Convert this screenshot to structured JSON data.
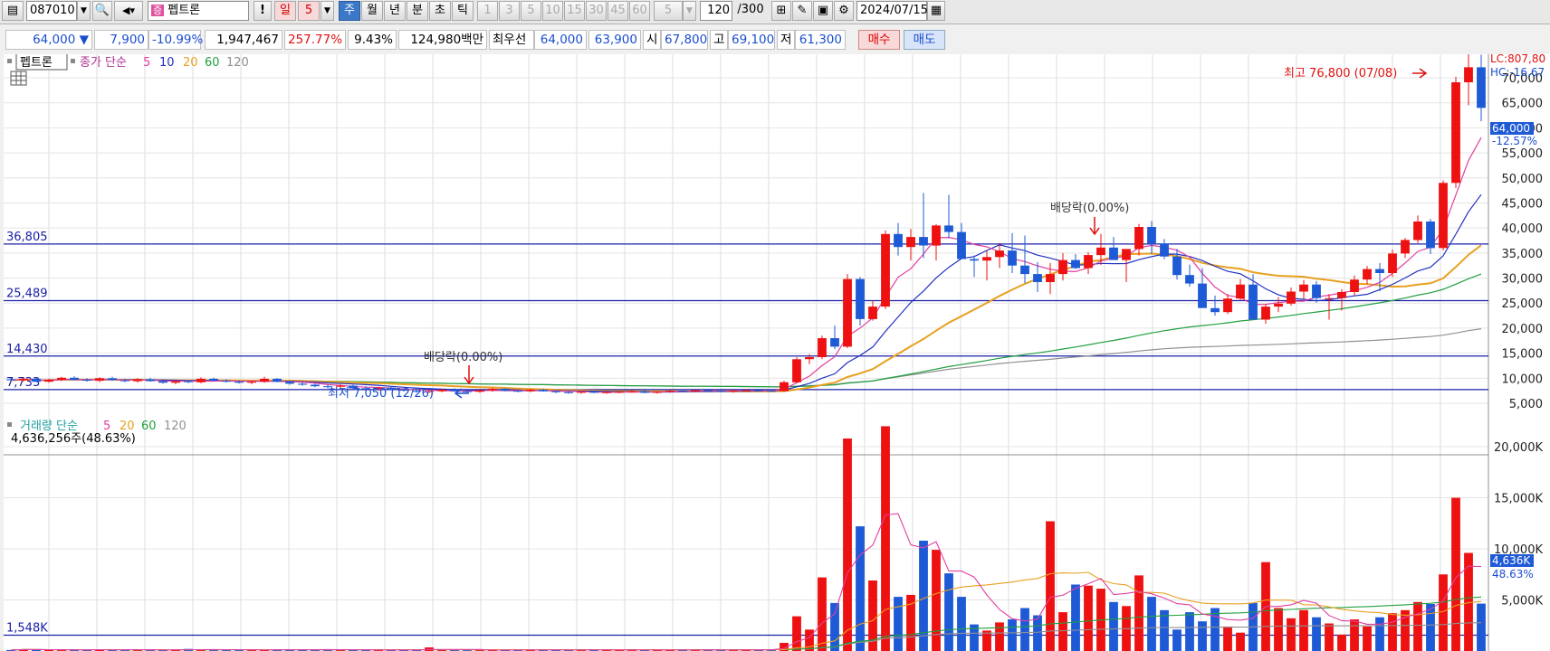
{
  "toolbar": {
    "code": "087010",
    "stock_badge": "증",
    "stock_name": "펩트론",
    "period_day": "일",
    "period_day_n": "5",
    "period_week": "주",
    "period_month": "월",
    "period_year": "년",
    "period_minute": "분",
    "period_second": "초",
    "period_tick": "틱",
    "intervals": [
      "1",
      "3",
      "5",
      "10",
      "15",
      "30",
      "45",
      "60"
    ],
    "interval_sel": "5",
    "count": "120",
    "count_max": "/300",
    "date": "2024/07/15"
  },
  "quote": {
    "price": "64,000",
    "change": "7,900",
    "change_pct": "-10.99%",
    "volume": "1,947,467",
    "volume_ratio": "257.77%",
    "turnover": "9.43%",
    "amount": "124,980백만",
    "best_label": "최우선",
    "best_ask": "64,000",
    "best_bid": "63,900",
    "open_label": "시",
    "open": "67,800",
    "high_label": "고",
    "high": "69,100",
    "low_label": "저",
    "low": "61,300",
    "buy_label": "매수",
    "sell_label": "매도"
  },
  "legend": {
    "name": "펩트론",
    "price_ma": "종가 단순",
    "periods": [
      "5",
      "10",
      "20",
      "60",
      "120"
    ],
    "vol_label": "거래량 단순",
    "vol_info": "4,636,256주(48.63%)"
  },
  "colors": {
    "up": "#ee1111",
    "down": "#1f5ad6",
    "ma5": "#e040a0",
    "ma10": "#2030c0",
    "ma20": "#e8a020",
    "ma60": "#20a040",
    "ma120": "#909090",
    "hline": "#1a20a8"
  },
  "chart_data": {
    "type": "candlestick",
    "period": "weekly",
    "price_axis": {
      "ticks": [
        5000,
        10000,
        15000,
        20000,
        25000,
        30000,
        35000,
        40000,
        45000,
        50000,
        55000,
        60000,
        65000,
        70000
      ],
      "tick_labels": [
        "5,000",
        "10,000",
        "15,000",
        "20,000",
        "25,000",
        "30,000",
        "35,000",
        "40,000",
        "45,000",
        "50,000",
        "55,000",
        "60,000",
        "65,000",
        "70,000"
      ],
      "ylim": [
        3000,
        78000
      ]
    },
    "volume_axis": {
      "ticks": [
        5000,
        10000,
        15000,
        20000
      ],
      "tick_labels": [
        "5,000K",
        "10,000K",
        "15,000K",
        "20,000K"
      ],
      "unit": "K"
    },
    "hlines": [
      {
        "label": "36,805",
        "value": 36805
      },
      {
        "label": "25,489",
        "value": 25489
      },
      {
        "label": "14,430",
        "value": 14430
      },
      {
        "label": "7,733",
        "value": 7733
      }
    ],
    "vol_hline": {
      "label": "1,548K",
      "value": 1548
    },
    "annotations": {
      "high": "최고 76,800 (07/08)",
      "low": "최저 7,050 (12/26)",
      "div1": "배당락(0.00%)",
      "div2": "배당락(0.00%)",
      "lc": "LC:807,80",
      "hc": "HC:-16,67",
      "last_price": "64,000",
      "last_pct": "-12.57%",
      "last_vol": "4,636K",
      "last_vol_pct": "48.63%"
    },
    "candles": [
      [
        9800,
        10200,
        9400,
        9600
      ],
      [
        9600,
        10100,
        9300,
        9900
      ],
      [
        9900,
        10000,
        9200,
        9300
      ],
      [
        9300,
        9900,
        9100,
        9700
      ],
      [
        9700,
        10300,
        9400,
        10100
      ],
      [
        10100,
        10400,
        9600,
        9700
      ],
      [
        9700,
        10000,
        9300,
        9500
      ],
      [
        9500,
        10200,
        9200,
        10000
      ],
      [
        10000,
        10300,
        9500,
        9600
      ],
      [
        9600,
        9900,
        9200,
        9400
      ],
      [
        9400,
        10000,
        9100,
        9800
      ],
      [
        9800,
        10100,
        9300,
        9400
      ],
      [
        9400,
        9800,
        8900,
        9100
      ],
      [
        9100,
        9600,
        8800,
        9400
      ],
      [
        9400,
        9700,
        9000,
        9200
      ],
      [
        9200,
        10200,
        9000,
        9900
      ],
      [
        9900,
        10100,
        9400,
        9500
      ],
      [
        9500,
        9800,
        9100,
        9300
      ],
      [
        9300,
        9600,
        8900,
        9100
      ],
      [
        9100,
        9500,
        8800,
        9300
      ],
      [
        9300,
        10300,
        9100,
        9900
      ],
      [
        9900,
        10000,
        9200,
        9300
      ],
      [
        9300,
        9500,
        8700,
        8900
      ],
      [
        8900,
        9300,
        8500,
        8700
      ],
      [
        8700,
        9000,
        8200,
        8400
      ],
      [
        8400,
        8800,
        8000,
        8300
      ],
      [
        8300,
        8800,
        7900,
        8500
      ],
      [
        8500,
        8700,
        7800,
        8000
      ],
      [
        8000,
        8400,
        7600,
        7900
      ],
      [
        7900,
        8300,
        7500,
        8100
      ],
      [
        8100,
        8400,
        7600,
        7700
      ],
      [
        7700,
        8000,
        7300,
        7500
      ],
      [
        7500,
        7800,
        7100,
        7300
      ],
      [
        7300,
        7600,
        7050,
        7400
      ],
      [
        7400,
        7900,
        7200,
        7700
      ],
      [
        7700,
        8000,
        7300,
        7400
      ],
      [
        7400,
        7700,
        7100,
        7300
      ],
      [
        7300,
        7700,
        7100,
        7600
      ],
      [
        7600,
        8100,
        7300,
        7900
      ],
      [
        7900,
        8000,
        7400,
        7500
      ],
      [
        7500,
        7800,
        7200,
        7400
      ],
      [
        7400,
        7900,
        7200,
        7700
      ],
      [
        7700,
        7900,
        7300,
        7400
      ],
      [
        7400,
        7600,
        7000,
        7200
      ],
      [
        7200,
        7500,
        6900,
        7100
      ],
      [
        7100,
        7400,
        6900,
        7300
      ],
      [
        7300,
        7500,
        7000,
        7100
      ],
      [
        7100,
        7400,
        6900,
        7200
      ],
      [
        7200,
        7500,
        7000,
        7300
      ],
      [
        7300,
        7600,
        7100,
        7400
      ],
      [
        7400,
        7600,
        7000,
        7100
      ],
      [
        7100,
        7400,
        6900,
        7300
      ],
      [
        7300,
        7600,
        7100,
        7500
      ],
      [
        7500,
        7800,
        7200,
        7400
      ],
      [
        7400,
        7700,
        7200,
        7600
      ],
      [
        7600,
        7900,
        7400,
        7500
      ],
      [
        7500,
        7700,
        7200,
        7300
      ],
      [
        7300,
        7600,
        7100,
        7500
      ],
      [
        7500,
        7800,
        7300,
        7600
      ],
      [
        7600,
        7900,
        7400,
        7500
      ],
      [
        7500,
        7800,
        7300,
        7400
      ],
      [
        7400,
        9500,
        7300,
        9200
      ],
      [
        9200,
        14200,
        9000,
        13800
      ],
      [
        13800,
        14800,
        12800,
        14200
      ],
      [
        14200,
        18500,
        13800,
        18000
      ],
      [
        18000,
        20500,
        15800,
        16300
      ],
      [
        16300,
        30800,
        16000,
        29800
      ],
      [
        29800,
        30200,
        20500,
        21800
      ],
      [
        21800,
        25500,
        21500,
        24300
      ],
      [
        24300,
        39500,
        23800,
        38800
      ],
      [
        38800,
        41000,
        34500,
        36200
      ],
      [
        36200,
        39800,
        33500,
        38200
      ],
      [
        38200,
        47000,
        34000,
        36500
      ],
      [
        36500,
        40800,
        33500,
        40500
      ],
      [
        40500,
        46600,
        38000,
        39200
      ],
      [
        39200,
        41000,
        34000,
        33800
      ],
      [
        33800,
        34500,
        30200,
        33500
      ],
      [
        33500,
        35500,
        29500,
        34200
      ],
      [
        34200,
        37000,
        32000,
        35500
      ],
      [
        35500,
        39000,
        31000,
        32500
      ],
      [
        32500,
        38500,
        29000,
        30800
      ],
      [
        30800,
        33200,
        27200,
        29200
      ],
      [
        29200,
        33000,
        26800,
        30800
      ],
      [
        30800,
        35000,
        29500,
        33600
      ],
      [
        33600,
        34800,
        31800,
        32000
      ],
      [
        32000,
        35200,
        30800,
        34600
      ],
      [
        34600,
        38800,
        32600,
        36100
      ],
      [
        36100,
        38200,
        33800,
        33600
      ],
      [
        33600,
        35800,
        29200,
        35800
      ],
      [
        35800,
        40800,
        34500,
        40200
      ],
      [
        40200,
        41400,
        34800,
        36900
      ],
      [
        36900,
        37800,
        33800,
        34300
      ],
      [
        34300,
        35800,
        29700,
        30600
      ],
      [
        30600,
        32700,
        28300,
        28900
      ],
      [
        28900,
        32000,
        25500,
        24000
      ],
      [
        24000,
        26500,
        22500,
        23200
      ],
      [
        23200,
        26800,
        22800,
        25900
      ],
      [
        25900,
        29800,
        25500,
        28700
      ],
      [
        28700,
        30800,
        21800,
        21700
      ],
      [
        21700,
        24800,
        20900,
        24300
      ],
      [
        24300,
        26200,
        23200,
        24900
      ],
      [
        24900,
        28100,
        24500,
        27300
      ],
      [
        27300,
        29600,
        25800,
        28700
      ],
      [
        28700,
        29400,
        25100,
        26000
      ],
      [
        26000,
        26800,
        21700,
        26000
      ],
      [
        26000,
        27800,
        23500,
        27200
      ],
      [
        27200,
        30500,
        26500,
        29700
      ],
      [
        29700,
        32400,
        28800,
        31800
      ],
      [
        31800,
        33000,
        27400,
        31000
      ],
      [
        31000,
        35700,
        30200,
        34900
      ],
      [
        34900,
        38000,
        34000,
        37600
      ],
      [
        37600,
        42500,
        37000,
        41300
      ],
      [
        41300,
        41800,
        34800,
        36000
      ],
      [
        36000,
        49500,
        35500,
        49000
      ],
      [
        49000,
        70200,
        48000,
        69100
      ],
      [
        69100,
        76800,
        64500,
        72100
      ],
      [
        72100,
        74600,
        61300,
        64000
      ]
    ],
    "volumes": [
      100,
      180,
      140,
      120,
      90,
      110,
      130,
      170,
      90,
      120,
      150,
      80,
      100,
      120,
      200,
      150,
      120,
      90,
      110,
      130,
      100,
      180,
      100,
      120,
      140,
      160,
      110,
      90,
      100,
      130,
      80,
      110,
      100,
      350,
      120,
      90,
      110,
      100,
      80,
      120,
      100,
      150,
      90,
      110,
      100,
      140,
      120,
      100,
      90,
      110,
      100,
      130,
      120,
      90,
      100,
      120,
      110,
      100,
      130,
      120,
      110,
      800,
      3400,
      2100,
      7200,
      4700,
      20800,
      12200,
      6900,
      22000,
      5300,
      5500,
      10800,
      9900,
      7600,
      5300,
      2600,
      2000,
      2800,
      3100,
      4200,
      3500,
      12700,
      3800,
      6500,
      6400,
      6100,
      4800,
      4400,
      7400,
      5300,
      4000,
      2100,
      3800,
      2900,
      4200,
      2400,
      1800,
      4700,
      8700,
      4200,
      3200,
      4000,
      3300,
      2700,
      1600,
      3100,
      2400,
      3300,
      3700,
      4000,
      4800,
      4600,
      7500,
      15000,
      9600,
      4636
    ]
  }
}
